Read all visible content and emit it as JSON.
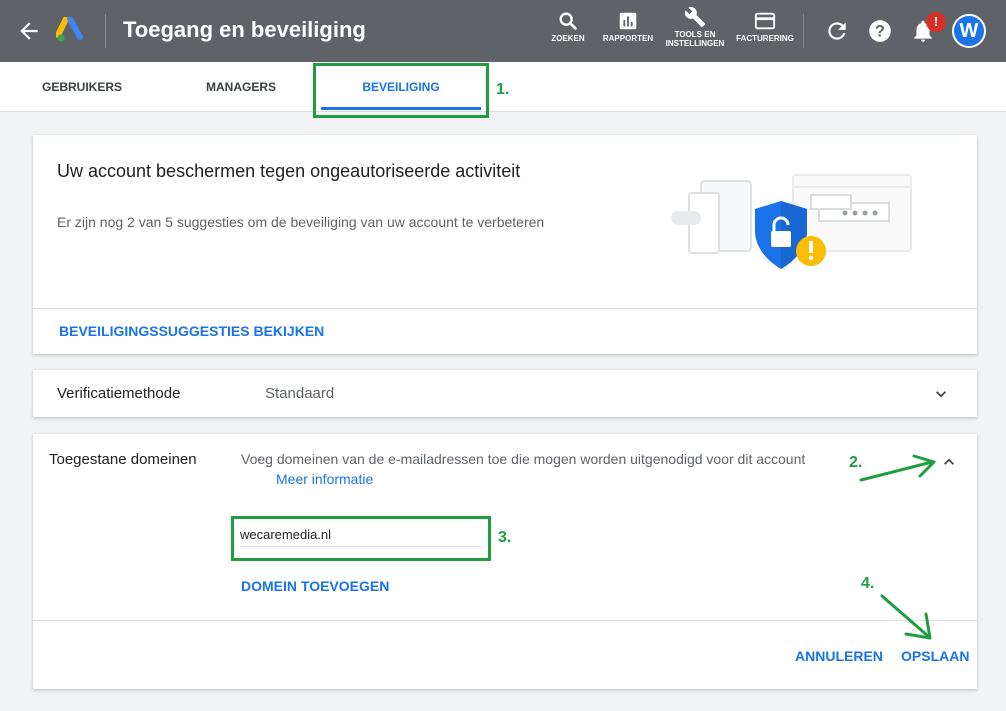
{
  "header": {
    "title": "Toegang en beveiliging",
    "tools": [
      {
        "label": "ZOEKEN",
        "icon": "search-icon"
      },
      {
        "label": "RAPPORTEN",
        "icon": "bar-chart-icon"
      },
      {
        "label": "TOOLS EN\nINSTELLINGEN",
        "icon": "wrench-icon"
      },
      {
        "label": "FACTURERING",
        "icon": "credit-card-icon"
      }
    ],
    "notification_badge": "!",
    "avatar_letter": "W"
  },
  "tabs": [
    {
      "label": "GEBRUIKERS",
      "active": false
    },
    {
      "label": "MANAGERS",
      "active": false
    },
    {
      "label": "BEVEILIGING",
      "active": true
    }
  ],
  "security_card": {
    "heading": "Uw account beschermen tegen ongeautoriseerde activiteit",
    "subtext": "Er zijn nog 2 van 5 suggesties om de beveiliging van uw account te verbeteren",
    "link": "BEVEILIGINGSSUGGESTIES BEKIJKEN"
  },
  "verification": {
    "label": "Verificatiemethode",
    "value": "Standaard"
  },
  "domains": {
    "label": "Toegestane domeinen",
    "description": "Voeg domeinen van de e-mailadressen toe die mogen worden uitgenodigd voor dit account",
    "more_info": "Meer informatie",
    "input_value": "wecaremedia.nl",
    "add_button": "DOMEIN TOEVOEGEN",
    "cancel_button": "ANNULEREN",
    "save_button": "OPSLAAN"
  },
  "annotations": [
    "1.",
    "2.",
    "3.",
    "4."
  ],
  "colors": {
    "header_bg": "#5f6368",
    "accent": "#1a73e8",
    "annotation": "#1e9e3e",
    "badge": "#d93025",
    "shield": "#1a73e8",
    "warning": "#fbbc04"
  }
}
